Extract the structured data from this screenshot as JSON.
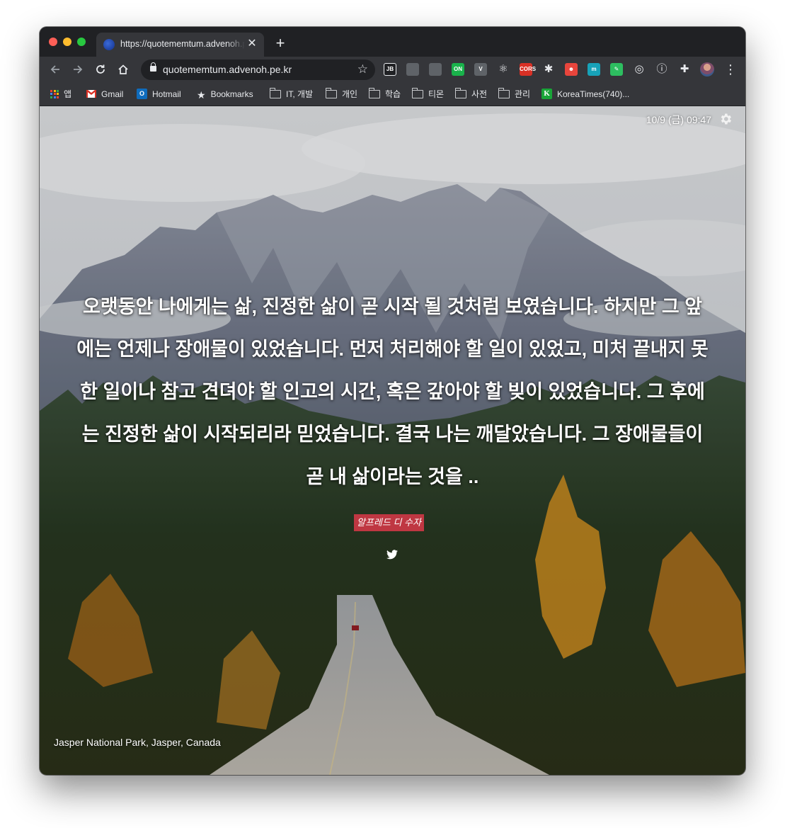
{
  "browser": {
    "tab_title": "https://quotememtum.advenoh.pe.kr",
    "tab_close": "✕",
    "new_tab": "+",
    "url": "quotememtum.advenoh.pe.kr",
    "bookmarks": [
      {
        "label": "앱",
        "icon": "apps-grid-icon"
      },
      {
        "label": "Gmail",
        "icon": "gmail-icon"
      },
      {
        "label": "Hotmail",
        "icon": "outlook-icon"
      },
      {
        "label": "Bookmarks",
        "icon": "star-icon"
      },
      {
        "label": "IT, 개발",
        "icon": "folder-icon"
      },
      {
        "label": "개인",
        "icon": "folder-icon"
      },
      {
        "label": "학습",
        "icon": "folder-icon"
      },
      {
        "label": "티몬",
        "icon": "folder-icon"
      },
      {
        "label": "사전",
        "icon": "folder-icon"
      },
      {
        "label": "관리",
        "icon": "folder-icon"
      },
      {
        "label": "KoreaTimes(740)...",
        "icon": "koreatimes-icon"
      }
    ],
    "extensions": [
      {
        "name": "jb-icon",
        "text": "JB",
        "color": "#202124"
      },
      {
        "name": "office-icon",
        "text": "",
        "color": "#5f6368"
      },
      {
        "name": "drive-icon",
        "text": "",
        "color": "#5f6368"
      },
      {
        "name": "naver-on-icon",
        "text": "ON",
        "color": "#19b24b"
      },
      {
        "name": "vue-icon",
        "text": "V",
        "color": "#5f6368"
      },
      {
        "name": "react-icon",
        "text": "⚛",
        "color": "#35363a"
      },
      {
        "name": "cors-icon",
        "text": "CORS",
        "color": "#d93025"
      },
      {
        "name": "asterisk-icon",
        "text": "✱",
        "color": "#35363a"
      },
      {
        "name": "robot-icon",
        "text": "☻",
        "color": "#e8453c"
      },
      {
        "name": "m-icon",
        "text": "m",
        "color": "#17a2b8"
      },
      {
        "name": "evernote-icon",
        "text": "✎",
        "color": "#2dbe60"
      },
      {
        "name": "target-icon",
        "text": "◎",
        "color": "#35363a"
      },
      {
        "name": "info-icon",
        "text": "ⓘ",
        "color": "#35363a"
      },
      {
        "name": "puzzle-icon",
        "text": "✚",
        "color": "#35363a"
      }
    ]
  },
  "page": {
    "datetime": "10/9 (금) 09:47",
    "quote": "오랫동안 나에게는 삶, 진정한 삶이 곧 시작 될 것처럼 보였습니다. 하지만 그 앞에는 언제나 장애물이 있었습니다. 먼저 처리해야 할 일이 있었고, 미처 끝내지 못한 일이나 참고 견뎌야 할 인고의 시간, 혹은 갚아야 할 빚이 있었습니다. 그 후에는 진정한 삶이 시작되리라 믿었습니다. 결국 나는 깨달았습니다. 그 장애물들이 곧 내 삶이라는 것을 ..",
    "author": "알프레드 디 수자",
    "location": "Jasper National Park, Jasper, Canada",
    "author_badge_color": "#bf3742"
  }
}
